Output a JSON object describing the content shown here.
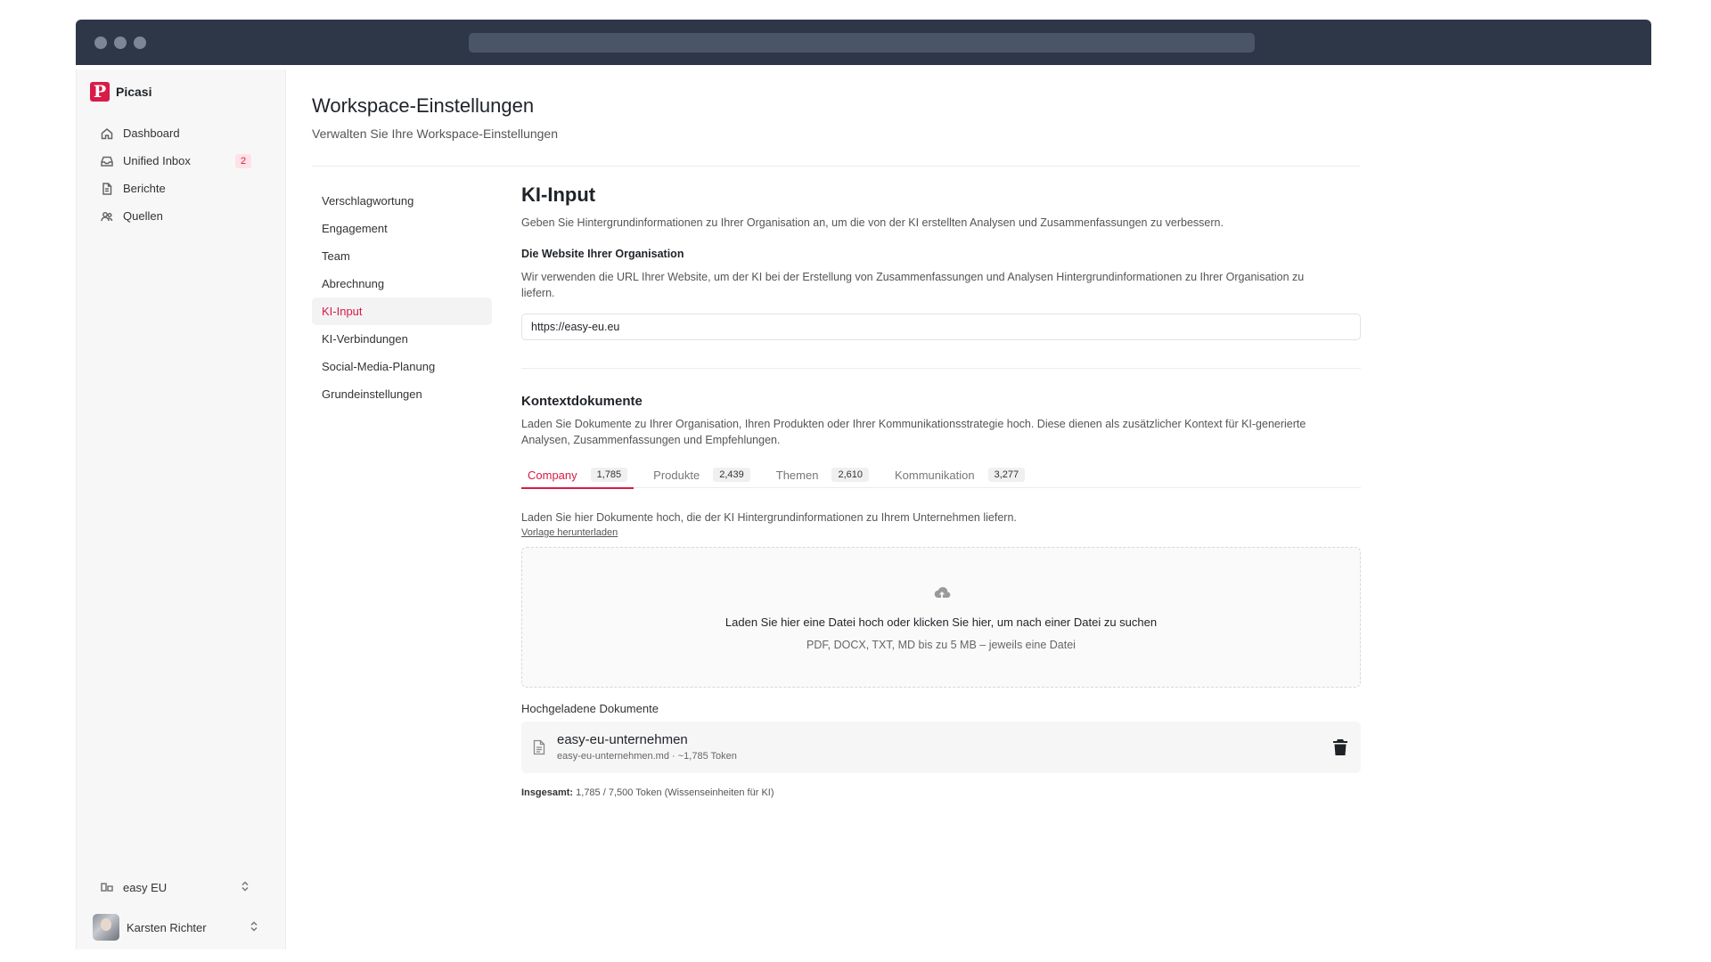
{
  "colors": {
    "accent": "#d81b47",
    "titlebar": "#2d3748"
  },
  "sidebar": {
    "brand": "Picasi",
    "brand_logo": "P",
    "items": [
      {
        "label": "Dashboard",
        "icon": "home-icon"
      },
      {
        "label": "Unified Inbox",
        "icon": "inbox-icon",
        "badge": "2"
      },
      {
        "label": "Berichte",
        "icon": "document-icon"
      },
      {
        "label": "Quellen",
        "icon": "sources-icon"
      }
    ],
    "workspace": "easy EU",
    "user": "Karsten Richter"
  },
  "page": {
    "title": "Workspace-Einstellungen",
    "subtitle": "Verwalten Sie Ihre Workspace-Einstellungen"
  },
  "subnav": [
    "Verschlagwortung",
    "Engagement",
    "Team",
    "Abrechnung",
    "KI-Input",
    "KI-Verbindungen",
    "Social-Media-Planung",
    "Grundeinstellungen"
  ],
  "subnav_active": "KI-Input",
  "ki_input": {
    "title": "KI-Input",
    "description": "Geben Sie Hintergrundinformationen zu Ihrer Organisation an, um die von der KI erstellten Analysen und Zusammenfassungen zu verbessern.",
    "website_label": "Die Website Ihrer Organisation",
    "website_help": "Wir verwenden die URL Ihrer Website, um der KI bei der Erstellung von Zusammenfassungen und Analysen Hintergrundinformationen zu Ihrer Organisation zu liefern.",
    "website_value": "https://easy-eu.eu"
  },
  "context_docs": {
    "title": "Kontextdokumente",
    "description": "Laden Sie Dokumente zu Ihrer Organisation, Ihren Produkten oder Ihrer Kommunikationsstrategie hoch. Diese dienen als zusätzlicher Kontext für KI-generierte Analysen, Zusammenfassungen und Empfehlungen.",
    "tabs": [
      {
        "label": "Company",
        "count": "1,785"
      },
      {
        "label": "Produkte",
        "count": "2,439"
      },
      {
        "label": "Themen",
        "count": "2,610"
      },
      {
        "label": "Kommunikation",
        "count": "3,277"
      }
    ],
    "active_tab": "Company",
    "upload_description": "Laden Sie hier Dokumente hoch, die der KI Hintergrundinformationen zu Ihrem Unternehmen liefern.",
    "template_link": "Vorlage herunterladen",
    "dropzone_main": "Laden Sie hier eine Datei hoch oder klicken Sie hier, um nach einer Datei zu suchen",
    "dropzone_sub": "PDF, DOCX, TXT, MD bis zu 5 MB – jeweils eine Datei",
    "uploaded_label": "Hochgeladene Dokumente",
    "documents": [
      {
        "name": "easy-eu-unternehmen",
        "meta": "easy-eu-unternehmen.md · ~1,785 Token"
      }
    ],
    "total_label": "Insgesamt:",
    "total_value": "1,785 / 7,500 Token (Wissenseinheiten für KI)"
  }
}
